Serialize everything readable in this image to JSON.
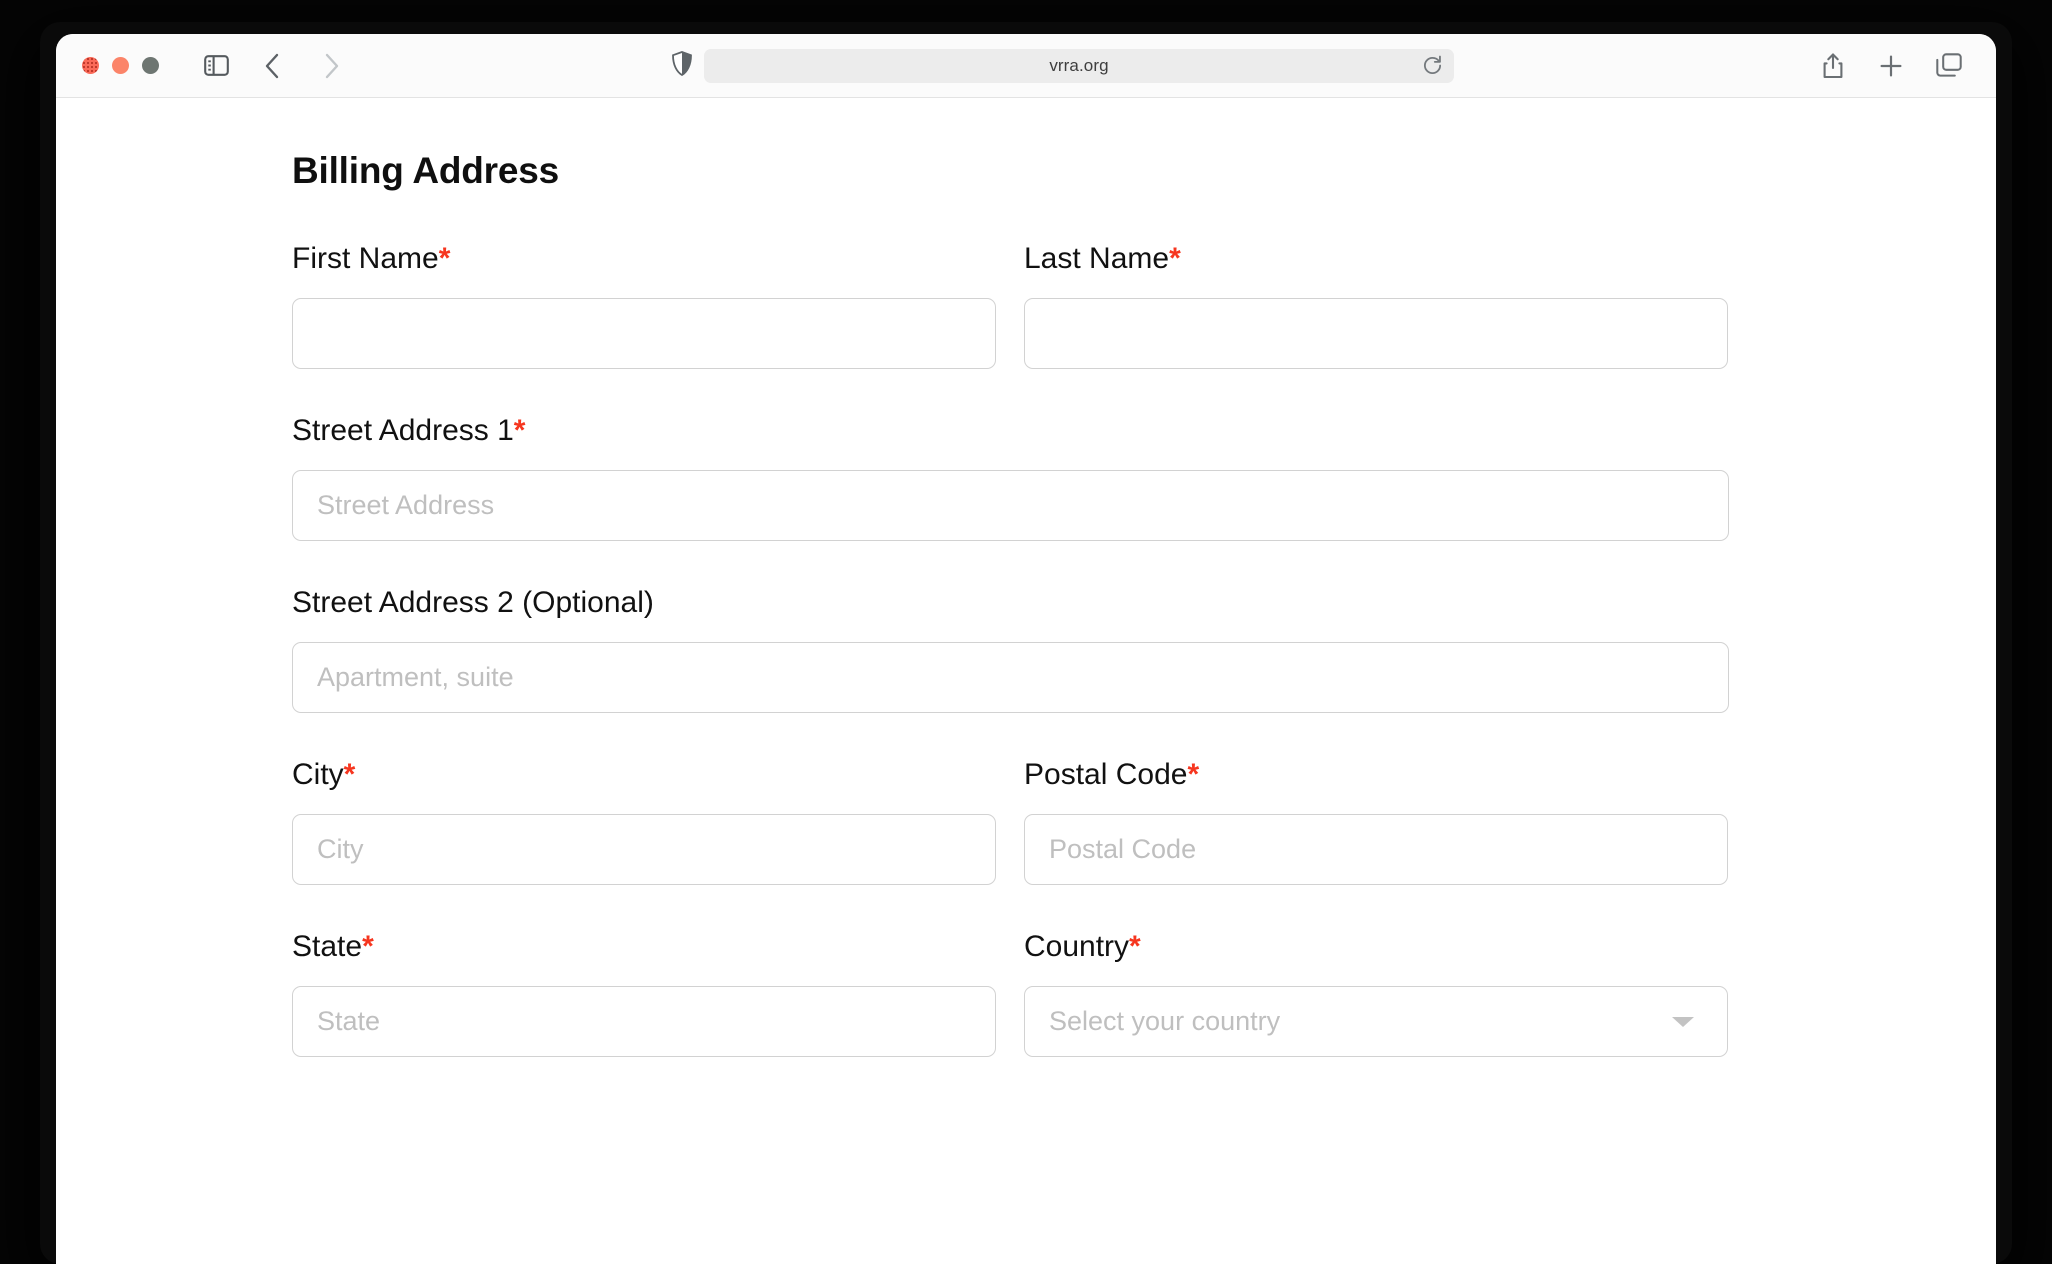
{
  "browser": {
    "url": "vrra.org",
    "traffic_lights": [
      {
        "name": "close-button",
        "color": "#fa6a58"
      },
      {
        "name": "minimize-button",
        "color": "#fb8469"
      },
      {
        "name": "maximize-button",
        "color": "#6e7672"
      }
    ],
    "toolbar_icons": {
      "sidebar_toggle": "sidebar-toggle-icon",
      "back": "back-chevron-icon",
      "forward": "forward-chevron-icon",
      "shield": "privacy-shield-icon",
      "reload": "reload-icon",
      "share": "share-icon",
      "new_tab": "plus-icon",
      "tab_overview": "tab-overview-icon"
    }
  },
  "page": {
    "title": "Billing Address",
    "required_marker": "*",
    "required_color": "#f6361f",
    "fields": {
      "first_name": {
        "label": "First Name",
        "required": true,
        "value": "",
        "placeholder": ""
      },
      "last_name": {
        "label": "Last Name",
        "required": true,
        "value": "",
        "placeholder": ""
      },
      "street_address_1": {
        "label": "Street Address 1",
        "required": true,
        "value": "",
        "placeholder": "Street Address"
      },
      "street_address_2": {
        "label": "Street Address 2 (Optional)",
        "required": false,
        "value": "",
        "placeholder": "Apartment, suite"
      },
      "city": {
        "label": "City",
        "required": true,
        "value": "",
        "placeholder": "City"
      },
      "postal_code": {
        "label": "Postal Code",
        "required": true,
        "value": "",
        "placeholder": "Postal Code"
      },
      "state": {
        "label": "State",
        "required": true,
        "value": "",
        "placeholder": "State"
      },
      "country": {
        "label": "Country",
        "required": true,
        "value": "",
        "placeholder": "Select your country",
        "selected_option": "Select your country"
      }
    }
  }
}
